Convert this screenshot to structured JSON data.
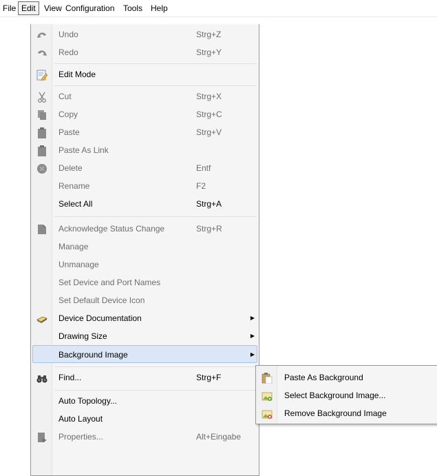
{
  "menubar": {
    "items": [
      "File",
      "Edit",
      "View",
      "Configuration",
      "Tools",
      "Help"
    ]
  },
  "edit_menu": {
    "items": [
      {
        "label": "Undo",
        "shortcut": "Strg+Z",
        "icon": "undo-icon",
        "enabled": false
      },
      {
        "label": "Redo",
        "shortcut": "Strg+Y",
        "icon": "redo-icon",
        "enabled": false
      },
      {
        "label": "Edit Mode",
        "shortcut": "",
        "icon": "edit-mode-icon",
        "enabled": true
      },
      {
        "label": "Cut",
        "shortcut": "Strg+X",
        "icon": "scissors-icon",
        "enabled": false
      },
      {
        "label": "Copy",
        "shortcut": "Strg+C",
        "icon": "copy-icon",
        "enabled": false
      },
      {
        "label": "Paste",
        "shortcut": "Strg+V",
        "icon": "paste-icon",
        "enabled": false
      },
      {
        "label": "Paste As Link",
        "shortcut": "",
        "icon": "paste-link-icon",
        "enabled": false
      },
      {
        "label": "Delete",
        "shortcut": "Entf",
        "icon": "delete-icon",
        "enabled": false
      },
      {
        "label": "Rename",
        "shortcut": "F2",
        "icon": "",
        "enabled": false
      },
      {
        "label": "Select All",
        "shortcut": "Strg+A",
        "icon": "",
        "enabled": true
      },
      {
        "label": "Acknowledge Status Change",
        "shortcut": "Strg+R",
        "icon": "acknowledge-icon",
        "enabled": false
      },
      {
        "label": "Manage",
        "shortcut": "",
        "icon": "",
        "enabled": false
      },
      {
        "label": "Unmanage",
        "shortcut": "",
        "icon": "",
        "enabled": false
      },
      {
        "label": "Set Device and Port Names",
        "shortcut": "",
        "icon": "",
        "enabled": false
      },
      {
        "label": "Set Default Device Icon",
        "shortcut": "",
        "icon": "",
        "enabled": false
      },
      {
        "label": "Device Documentation",
        "shortcut": "",
        "icon": "device-documentation-icon",
        "enabled": true,
        "submenu": true
      },
      {
        "label": "Drawing Size",
        "shortcut": "",
        "icon": "",
        "enabled": true,
        "submenu": true
      },
      {
        "label": "Background Image",
        "shortcut": "",
        "icon": "",
        "enabled": true,
        "submenu": true,
        "highlighted": true
      },
      {
        "label": "Find...",
        "shortcut": "Strg+F",
        "icon": "binoculars-icon",
        "enabled": true
      },
      {
        "label": "Auto Topology...",
        "shortcut": "",
        "icon": "",
        "enabled": true
      },
      {
        "label": "Auto Layout",
        "shortcut": "",
        "icon": "",
        "enabled": true
      },
      {
        "label": "Properties...",
        "shortcut": "Alt+Eingabe",
        "icon": "properties-icon",
        "enabled": false
      }
    ]
  },
  "background_submenu": {
    "items": [
      {
        "label": "Paste As Background",
        "icon": "paste-background-icon"
      },
      {
        "label": "Select Background Image...",
        "icon": "select-image-icon"
      },
      {
        "label": "Remove Background Image",
        "icon": "remove-image-icon"
      }
    ]
  },
  "colors": {
    "highlight_bg": "#dbe7f6",
    "highlight_border": "#a8c3e6",
    "disabled_text": "#6d6d6d"
  }
}
